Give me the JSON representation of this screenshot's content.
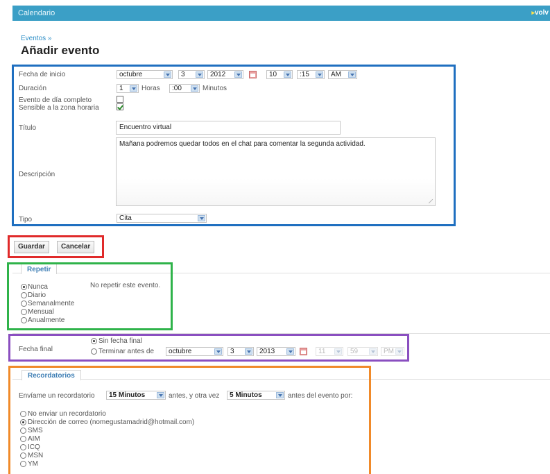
{
  "app": {
    "title": "Calendario",
    "back_label": "volv"
  },
  "breadcrumb": "Eventos »",
  "page_title": "Añadir evento",
  "event": {
    "start_label": "Fecha de inicio",
    "start_month": "octubre",
    "start_day": "3",
    "start_year": "2012",
    "start_hour": "10",
    "start_minute": ":15",
    "start_ampm": "AM",
    "duration_label": "Duración",
    "duration_hours": "1",
    "hours_label": "Horas",
    "duration_minutes": ":00",
    "minutes_label": "Minutos",
    "allday_label": "Evento de día completo",
    "allday_checked": false,
    "timezone_label": "Sensible a la zona horaria",
    "timezone_checked": true,
    "title_label": "Título",
    "title_value": "Encuentro virtual",
    "description_label": "Descripción",
    "description_value": "Mañana podremos quedar todos en el chat  para comentar la segunda actividad.",
    "type_label": "Tipo",
    "type_value": "Cita"
  },
  "actions": {
    "save": "Guardar",
    "cancel": "Cancelar"
  },
  "repeat": {
    "title": "Repetir",
    "options": [
      "Nunca",
      "Diario",
      "Semanalmente",
      "Mensual",
      "Anualmente"
    ],
    "selected": "Nunca",
    "note": "No repetir este evento."
  },
  "end": {
    "label": "Fecha final",
    "option_none": "Sin fecha final",
    "option_until": "Terminar antes de",
    "selected": "Sin fecha final",
    "month": "octubre",
    "day": "3",
    "year": "2013",
    "hour": "11",
    "minute": "59",
    "ampm": "PM"
  },
  "reminders": {
    "title": "Recordatorios",
    "send_label": "Envíame un recordatorio",
    "first_value": "15 Minutos",
    "middle_label": "antes, y otra vez",
    "second_value": "5 Minutos",
    "end_label": "antes del evento por:",
    "options": [
      "No enviar un recordatorio",
      "Dirección de correo (nomegustamadrid@hotmail.com)",
      "SMS",
      "AIM",
      "ICQ",
      "MSN",
      "YM"
    ],
    "selected": "Dirección de correo (nomegustamadrid@hotmail.com)"
  },
  "colors": {
    "header": "#3b9fc6",
    "frame_blue": "#1f6fc0",
    "frame_red": "#e02a2a",
    "frame_green": "#2fb34a",
    "frame_purple": "#8a4fc0",
    "frame_orange": "#f08a2a"
  }
}
